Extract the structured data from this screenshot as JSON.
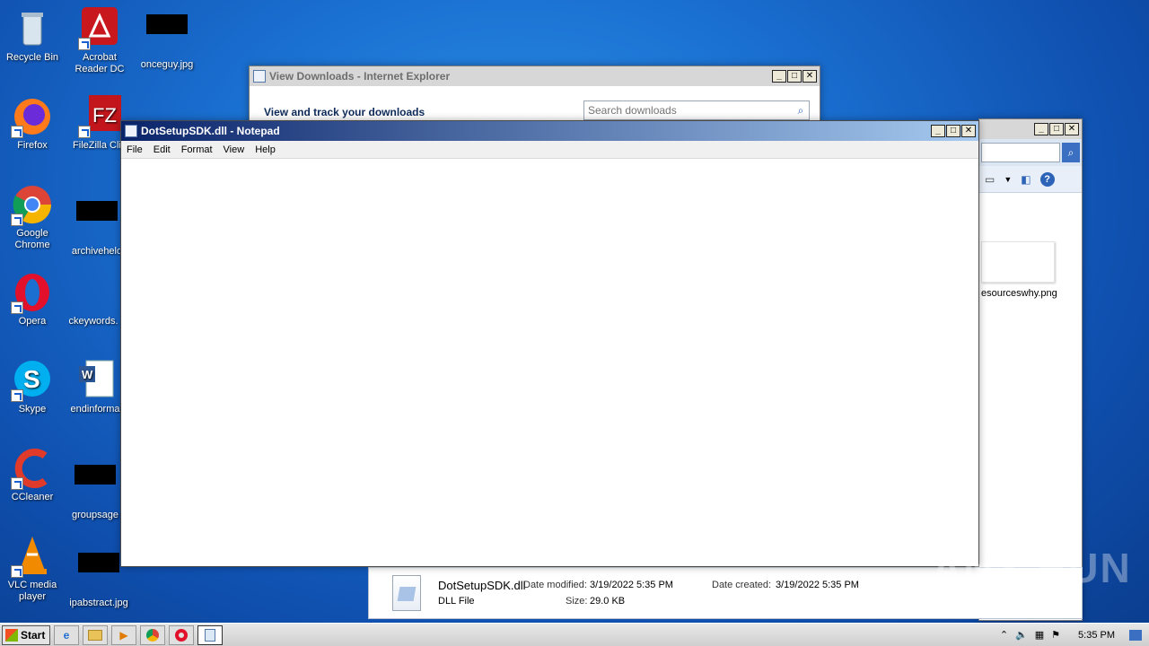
{
  "desktop": {
    "icons": [
      {
        "label": "Recycle Bin",
        "icon": "recycle-bin-icon"
      },
      {
        "label": "Acrobat Reader DC",
        "icon": "acrobat-icon"
      },
      {
        "label": "onceguy.jpg",
        "icon": "image-file-icon"
      },
      {
        "label": "Firefox",
        "icon": "firefox-icon"
      },
      {
        "label": "FileZilla Clie",
        "icon": "filezilla-icon"
      },
      {
        "label": "Google Chrome",
        "icon": "chrome-icon"
      },
      {
        "label": "archiveheld",
        "icon": "file-icon"
      },
      {
        "label": "Opera",
        "icon": "opera-icon"
      },
      {
        "label": "ckeywords.",
        "icon": "file-icon"
      },
      {
        "label": "Skype",
        "icon": "skype-icon"
      },
      {
        "label": "endinforma",
        "icon": "word-document-icon"
      },
      {
        "label": "CCleaner",
        "icon": "ccleaner-icon"
      },
      {
        "label": "groupsage",
        "icon": "file-icon"
      },
      {
        "label": "VLC media player",
        "icon": "vlc-icon"
      },
      {
        "label": "ipabstract.jpg",
        "icon": "image-file-icon"
      }
    ]
  },
  "ie_window": {
    "title": "View Downloads - Internet Explorer",
    "heading": "View and track your downloads",
    "search_placeholder": "Search downloads",
    "controls": {
      "minimize": "_",
      "maximize": "□",
      "close": "✕"
    }
  },
  "explorer_window": {
    "file_label": "esourceswhy.png",
    "details": {
      "filename": "DotSetupSDK.dll",
      "type": "DLL File",
      "date_modified_label": "Date modified:",
      "date_modified": "3/19/2022 5:35 PM",
      "date_created_label": "Date created:",
      "date_created": "3/19/2022 5:35 PM",
      "size_label": "Size:",
      "size": "29.0 KB"
    }
  },
  "notepad": {
    "title": "DotSetupSDK.dll - Notepad",
    "menu": [
      "File",
      "Edit",
      "Format",
      "View",
      "Help"
    ],
    "content": ""
  },
  "taskbar": {
    "start_label": "Start",
    "clock": "5:35 PM"
  },
  "watermark": "ANY RUN"
}
